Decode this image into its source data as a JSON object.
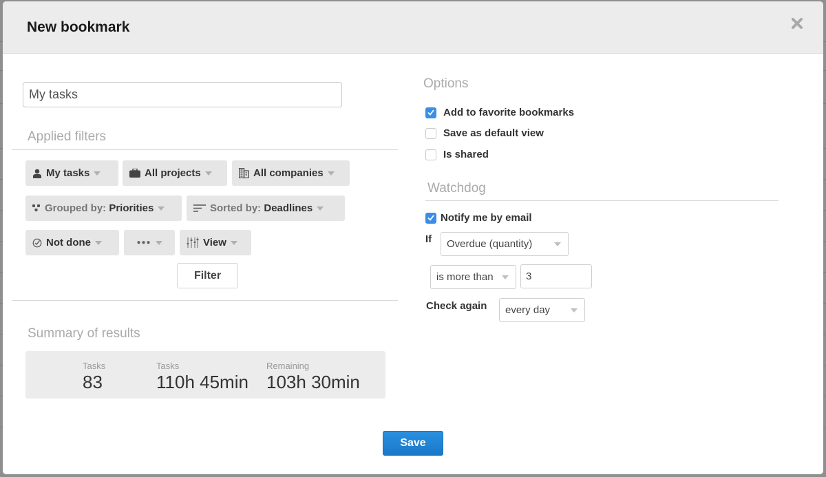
{
  "modal": {
    "title": "New bookmark",
    "close_icon": "close-x-icon"
  },
  "bookmark_name": {
    "value": "My tasks"
  },
  "applied_filters": {
    "title": "Applied filters",
    "chips": [
      {
        "icon": "user-icon",
        "label": "My tasks"
      },
      {
        "icon": "briefcase-icon",
        "label": "All projects"
      },
      {
        "icon": "building-icon",
        "label": "All companies"
      },
      {
        "icon": "group-icon",
        "prefix": "Grouped by:",
        "label": "Priorities"
      },
      {
        "icon": "sort-icon",
        "prefix": "Sorted by:",
        "label": "Deadlines"
      },
      {
        "icon": "check-circle-icon",
        "label": "Not done"
      },
      {
        "icon": "more-dots-icon",
        "label": "●●●"
      },
      {
        "icon": "sliders-icon",
        "label": "View"
      }
    ],
    "filter_button": "Filter"
  },
  "summary": {
    "title": "Summary of results",
    "stats": [
      {
        "label": "Tasks",
        "value": "83"
      },
      {
        "label": "Tasks",
        "value": "110h 45min"
      },
      {
        "label": "Remaining",
        "value": "103h 30min"
      }
    ]
  },
  "options": {
    "title": "Options",
    "items": [
      {
        "label": "Add to favorite bookmarks",
        "checked": true
      },
      {
        "label": "Save as default view",
        "checked": false
      },
      {
        "label": "Is shared",
        "checked": false
      }
    ]
  },
  "watchdog": {
    "title": "Watchdog",
    "notify": {
      "label": "Notify me by email",
      "checked": true
    },
    "if_label": "If",
    "condition_select": "Overdue (quantity)",
    "comparator_select": "is more than",
    "threshold_value": "3",
    "check_again_label": "Check again",
    "frequency_select": "every day"
  },
  "footer": {
    "save_label": "Save"
  },
  "colors": {
    "accent": "#1a78c9",
    "checkbox_checked": "#3a8ee6"
  }
}
